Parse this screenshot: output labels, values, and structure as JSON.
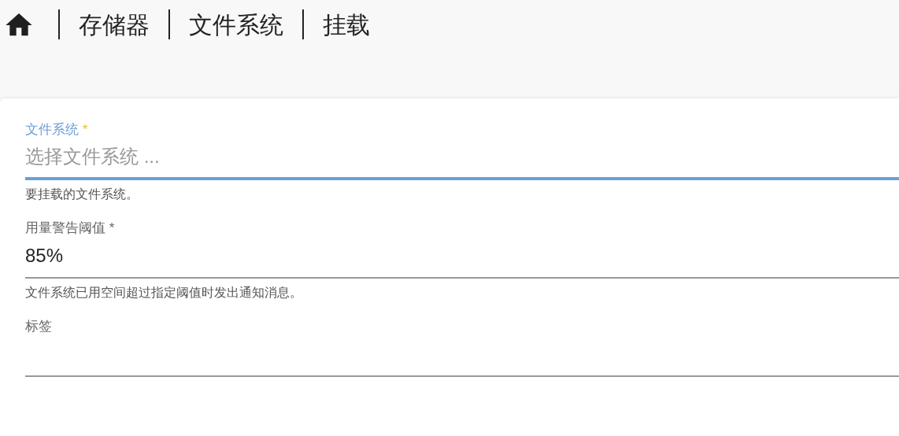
{
  "breadcrumb": [
    {
      "label": "存储器"
    },
    {
      "label": "文件系统"
    },
    {
      "label": "挂载"
    }
  ],
  "fields": [
    {
      "label": "文件系统",
      "required_mark": "*",
      "focused": true,
      "placeholder": "选择文件系统 ...",
      "hint": "要挂载的文件系统。"
    },
    {
      "label": "用量警告阈值",
      "required_mark": "*",
      "focused": false,
      "value": "85%",
      "hint": "文件系统已用空间超过指定阈值时发出通知消息。"
    },
    {
      "label": "标签",
      "focused": false
    }
  ]
}
